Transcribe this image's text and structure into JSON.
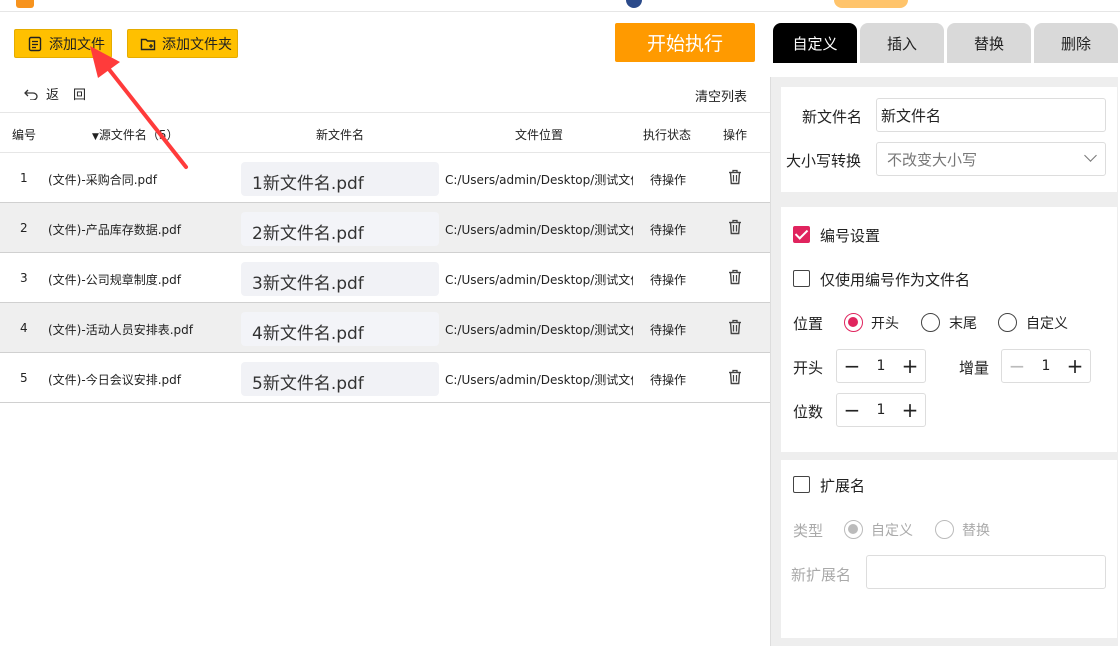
{
  "toolbar": {
    "add_file_label": "添加文件",
    "add_folder_label": "添加文件夹",
    "start_label": "开始执行"
  },
  "tabs": [
    "自定义",
    "插入",
    "替换",
    "删除"
  ],
  "list_bar": {
    "back_label": "返回",
    "clear_label": "清空列表"
  },
  "table": {
    "headers": {
      "num": "编号",
      "src": "源文件名（5）",
      "new": "新文件名",
      "loc": "文件位置",
      "status": "执行状态",
      "op": "操作"
    },
    "rows": [
      {
        "num": "1",
        "src": "(文件)-采购合同.pdf",
        "new": "1新文件名.pdf",
        "loc": "C:/Users/admin/Desktop/测试文件",
        "status": "待操作"
      },
      {
        "num": "2",
        "src": "(文件)-产品库存数据.pdf",
        "new": "2新文件名.pdf",
        "loc": "C:/Users/admin/Desktop/测试文件",
        "status": "待操作"
      },
      {
        "num": "3",
        "src": "(文件)-公司规章制度.pdf",
        "new": "3新文件名.pdf",
        "loc": "C:/Users/admin/Desktop/测试文件",
        "status": "待操作"
      },
      {
        "num": "4",
        "src": "(文件)-活动人员安排表.pdf",
        "new": "4新文件名.pdf",
        "loc": "C:/Users/admin/Desktop/测试文件",
        "status": "待操作"
      },
      {
        "num": "5",
        "src": "(文件)-今日会议安排.pdf",
        "new": "5新文件名.pdf",
        "loc": "C:/Users/admin/Desktop/测试文件",
        "status": "待操作"
      }
    ]
  },
  "panel": {
    "new_name_label": "新文件名",
    "new_name_value": "新文件名",
    "case_label": "大小写转换",
    "case_value": "不改变大小写",
    "numbering_label": "编号设置",
    "numbering_checked": true,
    "only_number_label": "仅使用编号作为文件名",
    "position_label": "位置",
    "position_options": [
      "开头",
      "末尾",
      "自定义"
    ],
    "start_label": "开头",
    "start_value": "1",
    "increment_label": "增量",
    "increment_value": "1",
    "digits_label": "位数",
    "digits_value": "1",
    "extension_label": "扩展名",
    "type_label": "类型",
    "type_options": [
      "自定义",
      "替换"
    ],
    "new_ext_label": "新扩展名",
    "new_ext_value": ""
  },
  "colors": {
    "accent": "#e0245e",
    "start_button": "#ff9a00",
    "toolbar_button": "#ffc000",
    "annotation_arrow": "#ff3b3b"
  }
}
